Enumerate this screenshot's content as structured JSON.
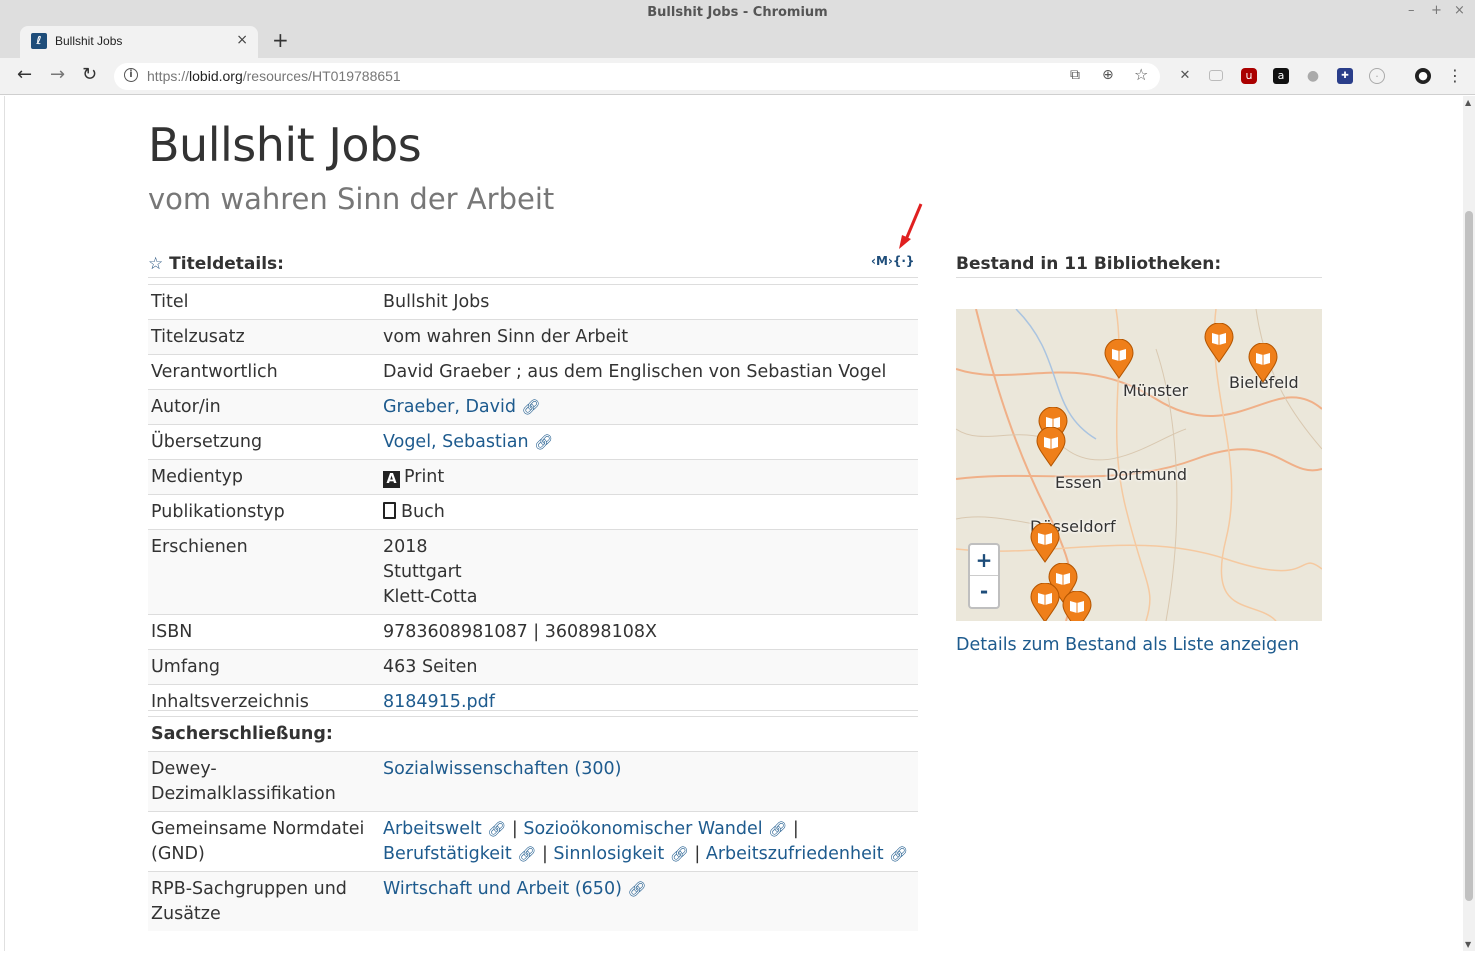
{
  "window": {
    "title": "Bullshit Jobs - Chromium"
  },
  "tab": {
    "title": "Bullshit Jobs",
    "close": "×",
    "new": "+"
  },
  "omnibox": {
    "url_prefix": "https://",
    "url_host": "lobid.org",
    "url_path": "/resources/HT019788651"
  },
  "page": {
    "title": "Bullshit Jobs",
    "subtitle": "vom wahren Sinn der Arbeit",
    "details_heading": "Titeldetails:",
    "format_label": "‹M›{·}",
    "details": [
      {
        "key": "Titel",
        "value": "Bullshit Jobs"
      },
      {
        "key": "Titelzusatz",
        "value": "vom wahren Sinn der Arbeit"
      },
      {
        "key": "Verantwortlich",
        "value": "David Graeber ; aus dem Englischen von Sebastian Vogel"
      },
      {
        "key": "Autor/in",
        "value": "Graeber, David"
      },
      {
        "key": "Übersetzung",
        "value": "Vogel, Sebastian"
      },
      {
        "key": "Medientyp",
        "value": "Print"
      },
      {
        "key": "Publikationstyp",
        "value": "Buch"
      },
      {
        "key": "Erschienen",
        "lines": [
          "2018",
          "Stuttgart",
          "Klett-Cotta"
        ]
      },
      {
        "key": "ISBN",
        "value": "9783608981087 | 360898108X"
      },
      {
        "key": "Umfang",
        "value": "463 Seiten"
      },
      {
        "key": "Inhaltsverzeichnis",
        "value": "8184915.pdf"
      }
    ],
    "subject_heading": "Sacherschließung:",
    "subjects": {
      "dewey_key": "Dewey-Dezimalklassifikation",
      "dewey_value": "Sozialwissenschaften (300)",
      "gnd_key": "Gemeinsame Normdatei (GND)",
      "gnd_values": [
        "Arbeitswelt",
        "Sozioökonomischer Wandel",
        "Berufstätigkeit",
        "Sinnlosigkeit",
        "Arbeitszufriedenheit"
      ],
      "rpb_key": "RPB-Sachgruppen und Zusätze",
      "rpb_value": "Wirtschaft und Arbeit (650)"
    },
    "holdings_heading": "Bestand in 11 Bibliotheken:",
    "holdings_link": "Details zum Bestand als Liste anzeigen",
    "map": {
      "cities": [
        "Münster",
        "Bielefeld",
        "Essen",
        "Dortmund",
        "Düsseldorf"
      ],
      "zoom_in": "+",
      "zoom_out": "-"
    }
  },
  "colors": {
    "link": "#1e5b8e",
    "marker": "#ef7f1a",
    "accent": "#1e4d7a"
  }
}
